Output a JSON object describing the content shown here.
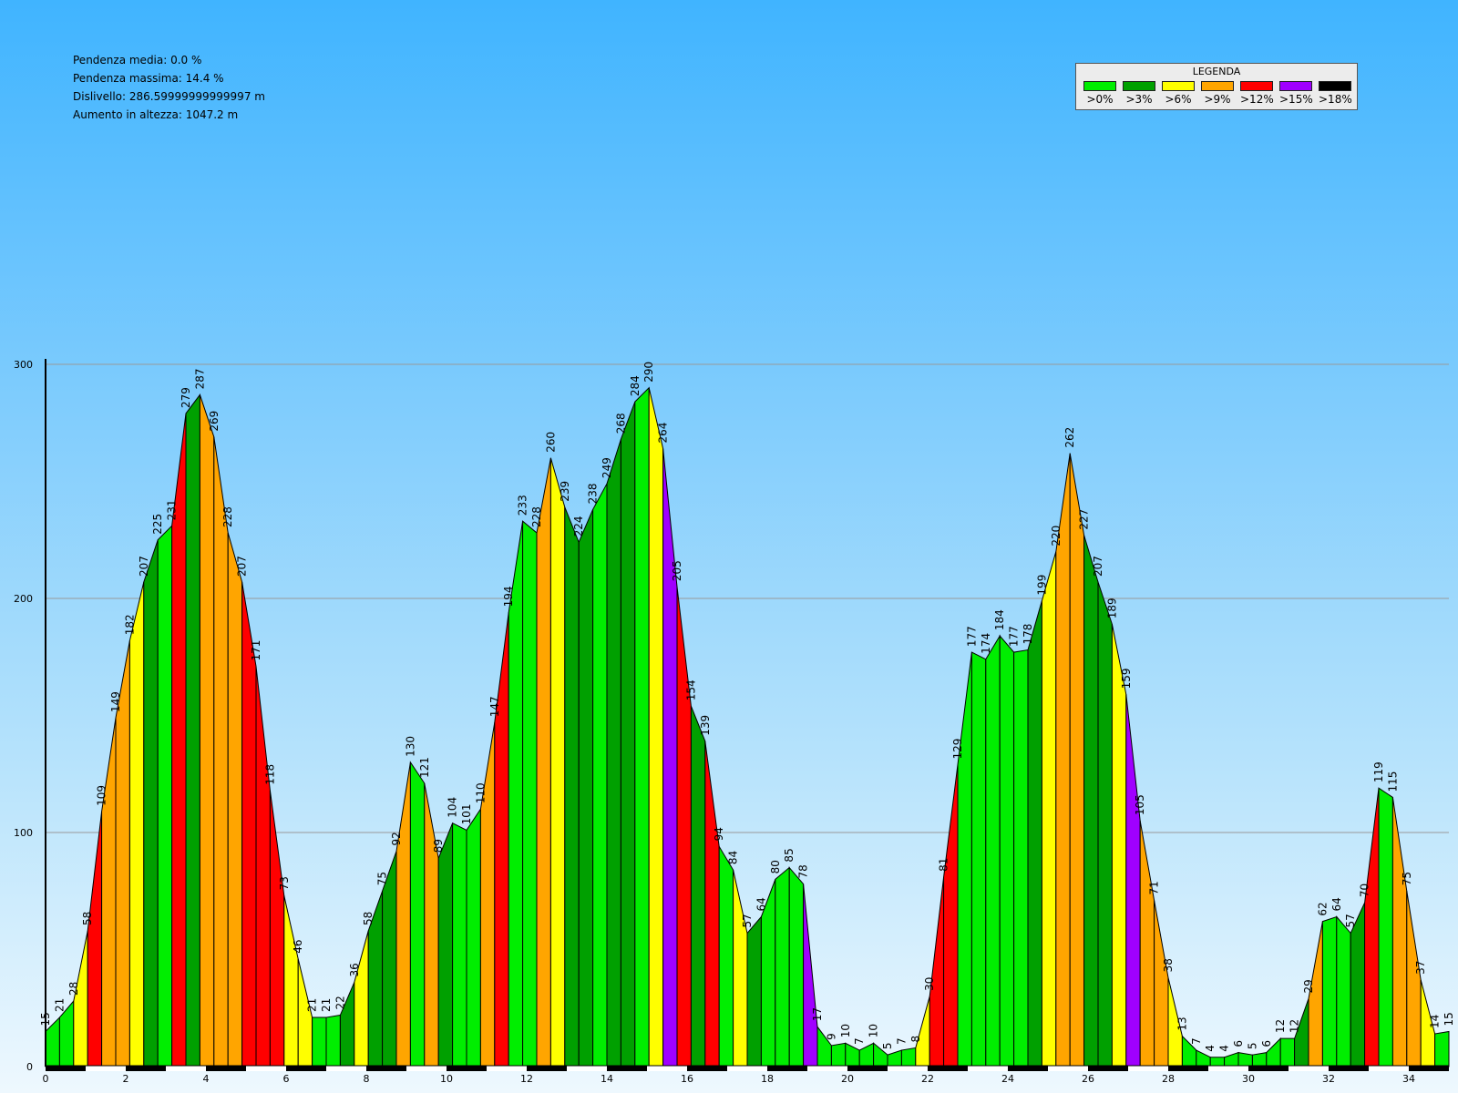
{
  "stats": {
    "avg_slope": "Pendenza media: 0.0 %",
    "max_slope": "Pendenza massima: 14.4 %",
    "height_diff": "Dislivello: 286.59999999999997 m",
    "elevation_gain": "Aumento in altezza: 1047.2 m"
  },
  "legend": {
    "title": "LEGENDA",
    "items": [
      {
        "label": ">0%",
        "color": "#00ee00"
      },
      {
        "label": ">3%",
        "color": "#00a000"
      },
      {
        "label": ">6%",
        "color": "#ffff00"
      },
      {
        "label": ">9%",
        "color": "#ffa500"
      },
      {
        "label": ">12%",
        "color": "#ff0000"
      },
      {
        "label": ">15%",
        "color": "#a000ff"
      },
      {
        "label": ">18%",
        "color": "#000000"
      }
    ]
  },
  "chart_data": {
    "type": "area",
    "xlim": [
      0,
      35
    ],
    "ylim": [
      0,
      300
    ],
    "x_ticks": [
      0,
      2,
      4,
      6,
      8,
      10,
      12,
      14,
      16,
      18,
      20,
      22,
      24,
      26,
      28,
      30,
      32,
      34
    ],
    "y_ticks": [
      0,
      100,
      200,
      300
    ],
    "grid": true,
    "segment_length_km": 0.35,
    "elevations": [
      15,
      21,
      28,
      58,
      109,
      149,
      182,
      207,
      225,
      231,
      279,
      287,
      269,
      228,
      207,
      171,
      118,
      73,
      46,
      21,
      21,
      22,
      36,
      58,
      75,
      92,
      130,
      121,
      89,
      104,
      101,
      110,
      147,
      194,
      233,
      228,
      260,
      239,
      224,
      238,
      249,
      268,
      284,
      290,
      264,
      205,
      154,
      139,
      94,
      84,
      57,
      64,
      80,
      85,
      78,
      17,
      9,
      10,
      7,
      10,
      5,
      7,
      8,
      30,
      81,
      129,
      177,
      174,
      184,
      177,
      178,
      199,
      220,
      262,
      227,
      207,
      189,
      159,
      105,
      71,
      38,
      13,
      7,
      4,
      4,
      6,
      5,
      6,
      12,
      12,
      29,
      62,
      64,
      57,
      70,
      119,
      115,
      75,
      37,
      14,
      15
    ],
    "segment_colors": [
      "#00ee00",
      "#00ee00",
      "#ffff00",
      "#ff0000",
      "#ffa500",
      "#ffa500",
      "#ffff00",
      "#00a000",
      "#00ee00",
      "#ff0000",
      "#00a000",
      "#ffa500",
      "#ffa500",
      "#ffa500",
      "#ff0000",
      "#ff0000",
      "#ff0000",
      "#ffff00",
      "#ffff00",
      "#00ee00",
      "#00ee00",
      "#00a000",
      "#ffff00",
      "#00a000",
      "#00a000",
      "#ffa500",
      "#00ee00",
      "#ffa500",
      "#00a000",
      "#00ee00",
      "#00ee00",
      "#ffa500",
      "#ff0000",
      "#00ee00",
      "#00ee00",
      "#ffa500",
      "#ffff00",
      "#00a000",
      "#00a000",
      "#00ee00",
      "#00a000",
      "#00a000",
      "#00ee00",
      "#ffff00",
      "#a000ff",
      "#ff0000",
      "#00a000",
      "#ff0000",
      "#00ee00",
      "#ffff00",
      "#00a000",
      "#00ee00",
      "#00ee00",
      "#00ee00",
      "#a000ff",
      "#00ee00",
      "#00ee00",
      "#00ee00",
      "#00ee00",
      "#00ee00",
      "#00ee00",
      "#00ee00",
      "#ffff00",
      "#ff0000",
      "#ff0000",
      "#00ee00",
      "#00ee00",
      "#00ee00",
      "#00ee00",
      "#00ee00",
      "#00a000",
      "#ffff00",
      "#ffa500",
      "#ffa500",
      "#00a000",
      "#00a000",
      "#ffff00",
      "#a000ff",
      "#ffa500",
      "#ffa500",
      "#ffff00",
      "#00ee00",
      "#00ee00",
      "#00ee00",
      "#00ee00",
      "#00ee00",
      "#00ee00",
      "#00ee00",
      "#00ee00",
      "#00a000",
      "#ffa500",
      "#00ee00",
      "#00ee00",
      "#00a000",
      "#ff0000",
      "#00ee00",
      "#ffa500",
      "#ffa500",
      "#ffff00",
      "#00ee00"
    ]
  }
}
